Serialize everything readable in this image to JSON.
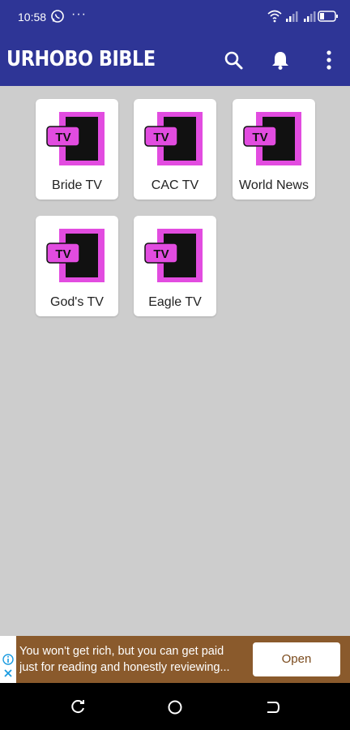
{
  "status_bar": {
    "time": "10:58",
    "dots": "···",
    "icons": [
      "whatsapp-icon",
      "wifi-icon",
      "signal-icon",
      "signal-icon",
      "battery-icon"
    ]
  },
  "app_bar": {
    "title": "URHOBO BIBLE",
    "actions": [
      "search-icon",
      "bell-icon",
      "more-vert-icon"
    ]
  },
  "channels": [
    {
      "label": "Bride TV",
      "badge": "TV"
    },
    {
      "label": "CAC TV",
      "badge": "TV"
    },
    {
      "label": "World News",
      "badge": "TV"
    },
    {
      "label": "God's TV",
      "badge": "TV"
    },
    {
      "label": "Eagle TV",
      "badge": "TV"
    }
  ],
  "ad": {
    "line1": "You won't get rich, but you can get paid",
    "line2": "just for reading and honestly reviewing...",
    "button": "Open"
  },
  "colors": {
    "primary": "#2e3596",
    "background": "#cdcdcd",
    "tv_pink": "#e24ce0",
    "ad_brown": "#8a5a2c"
  }
}
